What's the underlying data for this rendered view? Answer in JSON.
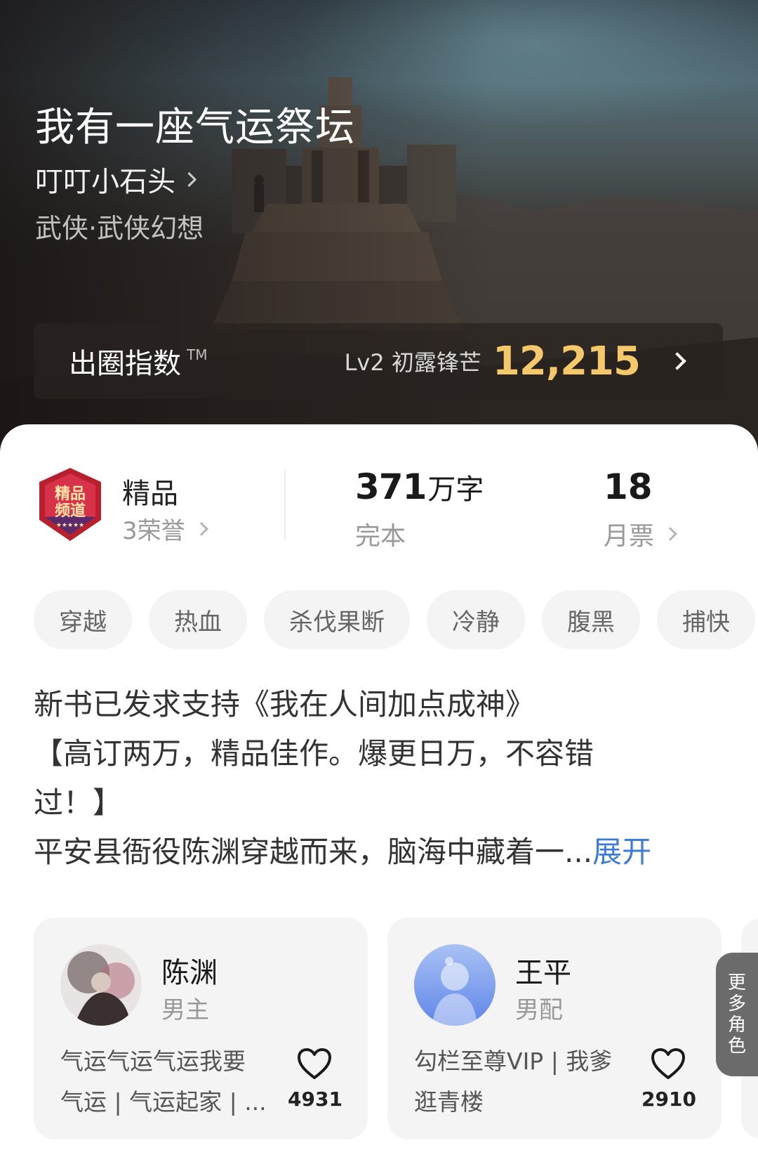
{
  "book": {
    "title": "我有一座气运祭坛",
    "author": "叮叮小石头",
    "genre": "武侠·武侠幻想"
  },
  "index": {
    "label": "出圈指数",
    "tm": "TM",
    "level": "Lv2 初露锋芒",
    "value": "12,215"
  },
  "stats": {
    "badge_text": "精品频道",
    "quality": "精品",
    "honors": "3荣誉",
    "word_count": "371",
    "word_unit": "万字",
    "status": "完本",
    "votes": "18",
    "votes_label": "月票"
  },
  "tags": [
    "穿越",
    "热血",
    "杀伐果断",
    "冷静",
    "腹黑",
    "捕快"
  ],
  "synopsis": {
    "line1": "新书已发求支持《我在人间加点成神》",
    "line2": "【高订两万，精品佳作。爆更日万，不容错",
    "line3": "过！】",
    "line4": "平安县衙役陈渊穿越而来，脑海中藏着一...",
    "expand": "展开"
  },
  "roles": [
    {
      "name": "陈渊",
      "type": "男主",
      "desc_line1": "气运气运气运我要",
      "desc_line2": "气运 | 气运起家 | ...",
      "likes": "4931"
    },
    {
      "name": "王平",
      "type": "男配",
      "desc_line1": "勾栏至尊VIP | 我爹",
      "desc_line2": "逛青楼",
      "likes": "2910"
    }
  ],
  "more_roles": [
    "更",
    "多",
    "角",
    "色"
  ],
  "colors": {
    "accent_gold": "#f5c96b",
    "link_blue": "#3d7bd6"
  }
}
